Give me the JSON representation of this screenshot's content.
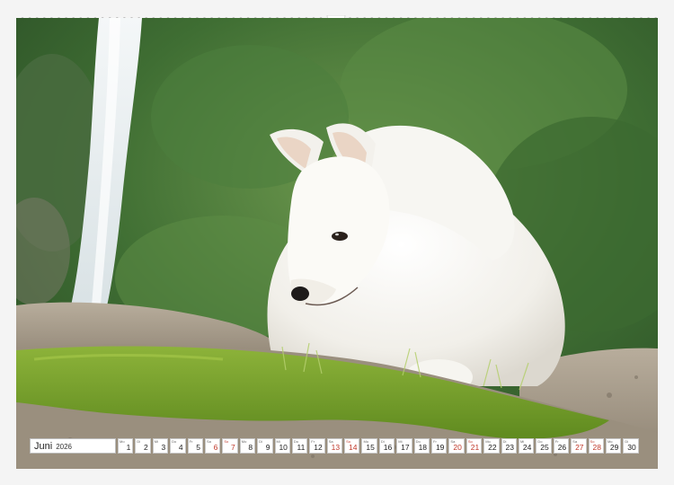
{
  "calendar": {
    "month": "Juni",
    "year": "2026",
    "days": [
      {
        "wd": "Mo",
        "num": "1",
        "weekend": ""
      },
      {
        "wd": "Di",
        "num": "2",
        "weekend": ""
      },
      {
        "wd": "Mi",
        "num": "3",
        "weekend": ""
      },
      {
        "wd": "Do",
        "num": "4",
        "weekend": ""
      },
      {
        "wd": "Fr",
        "num": "5",
        "weekend": ""
      },
      {
        "wd": "Sa",
        "num": "6",
        "weekend": "sat"
      },
      {
        "wd": "So",
        "num": "7",
        "weekend": "sun"
      },
      {
        "wd": "Mo",
        "num": "8",
        "weekend": ""
      },
      {
        "wd": "Di",
        "num": "9",
        "weekend": ""
      },
      {
        "wd": "Mi",
        "num": "10",
        "weekend": ""
      },
      {
        "wd": "Do",
        "num": "11",
        "weekend": ""
      },
      {
        "wd": "Fr",
        "num": "12",
        "weekend": ""
      },
      {
        "wd": "Sa",
        "num": "13",
        "weekend": "sat"
      },
      {
        "wd": "So",
        "num": "14",
        "weekend": "sun"
      },
      {
        "wd": "Mo",
        "num": "15",
        "weekend": ""
      },
      {
        "wd": "Di",
        "num": "16",
        "weekend": ""
      },
      {
        "wd": "Mi",
        "num": "17",
        "weekend": ""
      },
      {
        "wd": "Do",
        "num": "18",
        "weekend": ""
      },
      {
        "wd": "Fr",
        "num": "19",
        "weekend": ""
      },
      {
        "wd": "Sa",
        "num": "20",
        "weekend": "sat"
      },
      {
        "wd": "So",
        "num": "21",
        "weekend": "sun"
      },
      {
        "wd": "Mo",
        "num": "22",
        "weekend": ""
      },
      {
        "wd": "Di",
        "num": "23",
        "weekend": ""
      },
      {
        "wd": "Mi",
        "num": "24",
        "weekend": ""
      },
      {
        "wd": "Do",
        "num": "25",
        "weekend": ""
      },
      {
        "wd": "Fr",
        "num": "26",
        "weekend": ""
      },
      {
        "wd": "Sa",
        "num": "27",
        "weekend": "sat"
      },
      {
        "wd": "So",
        "num": "28",
        "weekend": "sun"
      },
      {
        "wd": "Mo",
        "num": "29",
        "weekend": ""
      },
      {
        "wd": "Di",
        "num": "30",
        "weekend": ""
      }
    ]
  },
  "photo": {
    "subject": "white-samoyed-puppy-icon",
    "colors": {
      "foliage": "#4a7a3a",
      "moss": "#7fa52a",
      "rock": "#a89c8a",
      "fur": "#f5f3ee",
      "waterfall": "#e9eef0"
    }
  },
  "binding": {
    "icon": "wire-binding-icon",
    "hanger_icon": "hanger-notch-icon"
  }
}
